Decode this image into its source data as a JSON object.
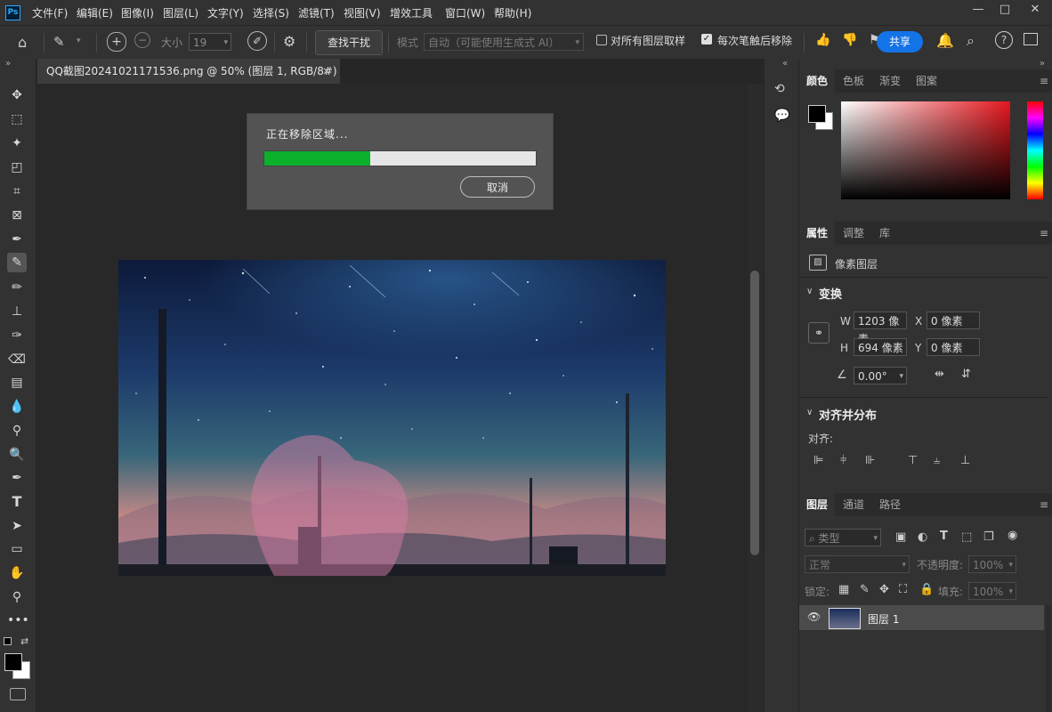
{
  "app": {
    "logo": "Ps"
  },
  "menu": [
    "文件(F)",
    "编辑(E)",
    "图像(I)",
    "图层(L)",
    "文字(Y)",
    "选择(S)",
    "滤镜(T)",
    "视图(V)",
    "增效工具",
    "窗口(W)",
    "帮助(H)"
  ],
  "window": {
    "minimize": "—",
    "maximize": "□",
    "close": "✕"
  },
  "options": {
    "size_label": "大小",
    "size_value": "19",
    "find_distractions": "查找干扰",
    "mode_label": "模式",
    "mode_value": "自动（可能使用生成式 AI）",
    "sample_all_layers": "对所有图层取样",
    "remove_after_stroke": "每次笔触后移除",
    "share": "共享",
    "sample_all_checked": false,
    "remove_after_checked": true
  },
  "document": {
    "tab_title": "QQ截图20241021171536.png @ 50% (图层 1, RGB/8#) *",
    "close": "×"
  },
  "dialog": {
    "message": "正在移除区域...",
    "progress": 0.39,
    "cancel": "取消"
  },
  "color_panel": {
    "tabs": [
      "颜色",
      "色板",
      "渐变",
      "图案"
    ],
    "active": 0
  },
  "properties_panel": {
    "tabs": [
      "属性",
      "调整",
      "库"
    ],
    "active": 0,
    "layer_type": "像素图层",
    "transform_header": "变换",
    "w_label": "W",
    "w_value": "1203 像素",
    "h_label": "H",
    "h_value": "694 像素",
    "x_label": "X",
    "x_value": "0 像素",
    "y_label": "Y",
    "y_value": "0 像素",
    "angle_value": "0.00°",
    "align_header": "对齐并分布",
    "align_label": "对齐:"
  },
  "layers_panel": {
    "tabs": [
      "图层",
      "通道",
      "路径"
    ],
    "active": 0,
    "filter_placeholder": "类型",
    "blend_mode": "正常",
    "opacity_label": "不透明度:",
    "opacity_value": "100%",
    "lock_label": "锁定:",
    "fill_label": "填充:",
    "fill_value": "100%",
    "layers": [
      {
        "name": "图层 1",
        "visible": true
      }
    ]
  },
  "colors": {
    "accent": "#1473e6",
    "progress": "#0db02b",
    "foreground": "#000000",
    "background": "#ffffff"
  }
}
